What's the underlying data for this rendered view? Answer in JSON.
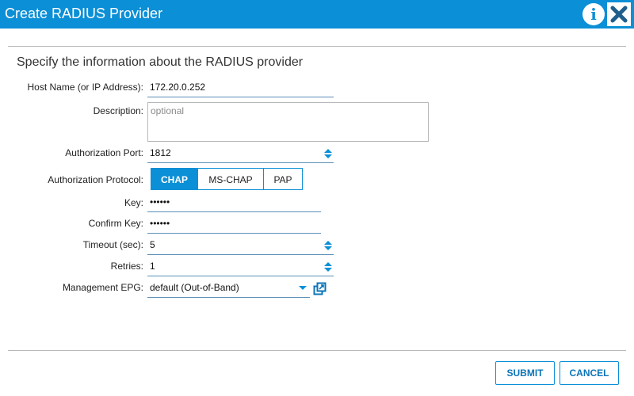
{
  "dialog": {
    "title": "Create RADIUS Provider",
    "info_glyph": "i",
    "section_title": "Specify the information about the RADIUS provider"
  },
  "form": {
    "host_name": {
      "label": "Host Name (or IP Address):",
      "value": "172.20.0.252"
    },
    "description": {
      "label": "Description:",
      "placeholder": "optional"
    },
    "authorization_port": {
      "label": "Authorization Port:",
      "value": "1812"
    },
    "authorization_protocol": {
      "label": "Authorization Protocol:",
      "options": [
        "CHAP",
        "MS-CHAP",
        "PAP"
      ],
      "selected": "CHAP"
    },
    "key": {
      "label": "Key:",
      "value": "••••••"
    },
    "confirm_key": {
      "label": "Confirm Key:",
      "value": "••••••"
    },
    "timeout": {
      "label": "Timeout (sec):",
      "value": "5"
    },
    "retries": {
      "label": "Retries:",
      "value": "1"
    },
    "management_epg": {
      "label": "Management EPG:",
      "value": "default (Out-of-Band)"
    }
  },
  "footer": {
    "submit_label": "SUBMIT",
    "cancel_label": "CANCEL"
  },
  "colors": {
    "accent": "#0b8fd6",
    "field_underline": "#5a8fb8"
  },
  "icons": [
    "info-icon",
    "close-icon",
    "stepper-icon",
    "chevron-down-icon",
    "popout-icon"
  ]
}
